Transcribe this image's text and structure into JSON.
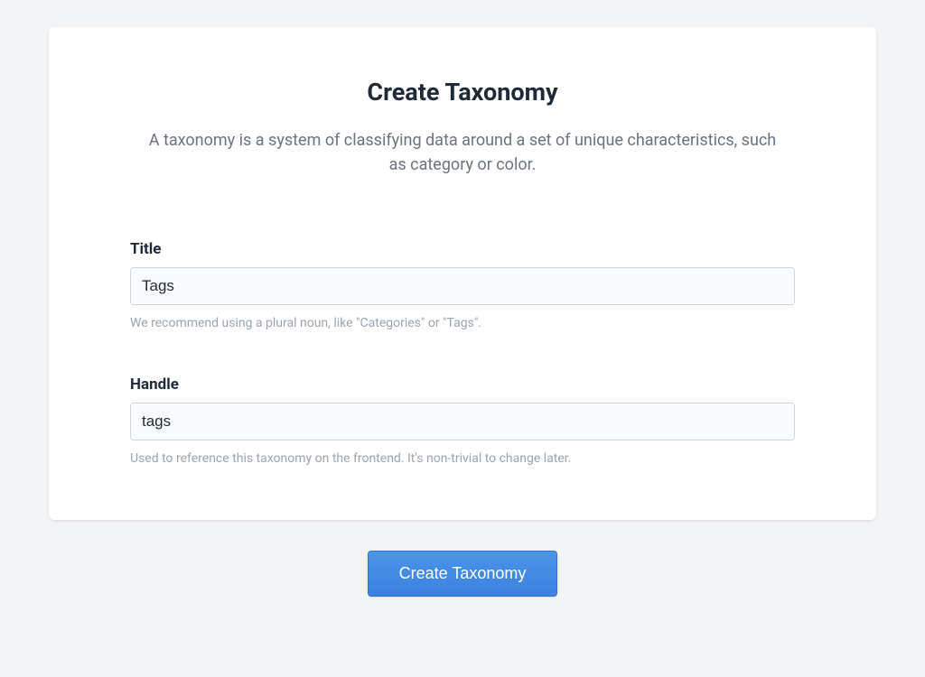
{
  "header": {
    "title": "Create Taxonomy",
    "description": "A taxonomy is a system of classifying data around a set of unique characteristics, such as category or color."
  },
  "form": {
    "title": {
      "label": "Title",
      "value": "Tags",
      "help": "We recommend using a plural noun, like \"Categories\" or \"Tags\"."
    },
    "handle": {
      "label": "Handle",
      "value": "tags",
      "help": "Used to reference this taxonomy on the frontend. It's non-trivial to change later."
    }
  },
  "actions": {
    "submit_label": "Create Taxonomy"
  }
}
